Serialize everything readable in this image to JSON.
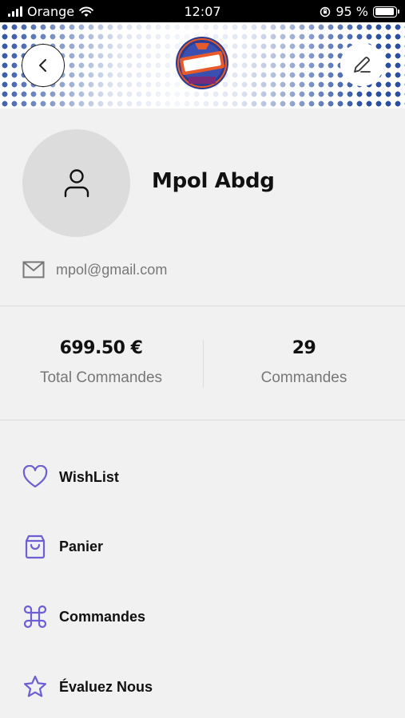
{
  "status_bar": {
    "carrier": "Orange",
    "time": "12:07",
    "battery": "95 %",
    "battery_level": 0.95
  },
  "header": {
    "logo_icon": "dstreet-tacos-halal-logo",
    "back_icon": "chevron-left-icon",
    "edit_icon": "pencil-icon",
    "pattern_color": "#2a4fa3"
  },
  "profile": {
    "name": "Mpol Abdg",
    "email": "mpol@gmail.com",
    "avatar_icon": "user-icon"
  },
  "stats": [
    {
      "value": "699.50 €",
      "label": "Total Commandes"
    },
    {
      "value": "29",
      "label": "Commandes"
    }
  ],
  "menu": {
    "items": [
      {
        "label": "WishList",
        "icon": "heart-icon"
      },
      {
        "label": "Panier",
        "icon": "shopping-bag-icon"
      },
      {
        "label": "Commandes",
        "icon": "command-icon"
      },
      {
        "label": "Évaluez Nous",
        "icon": "star-icon"
      }
    ],
    "accent": "#6b5fd3"
  }
}
